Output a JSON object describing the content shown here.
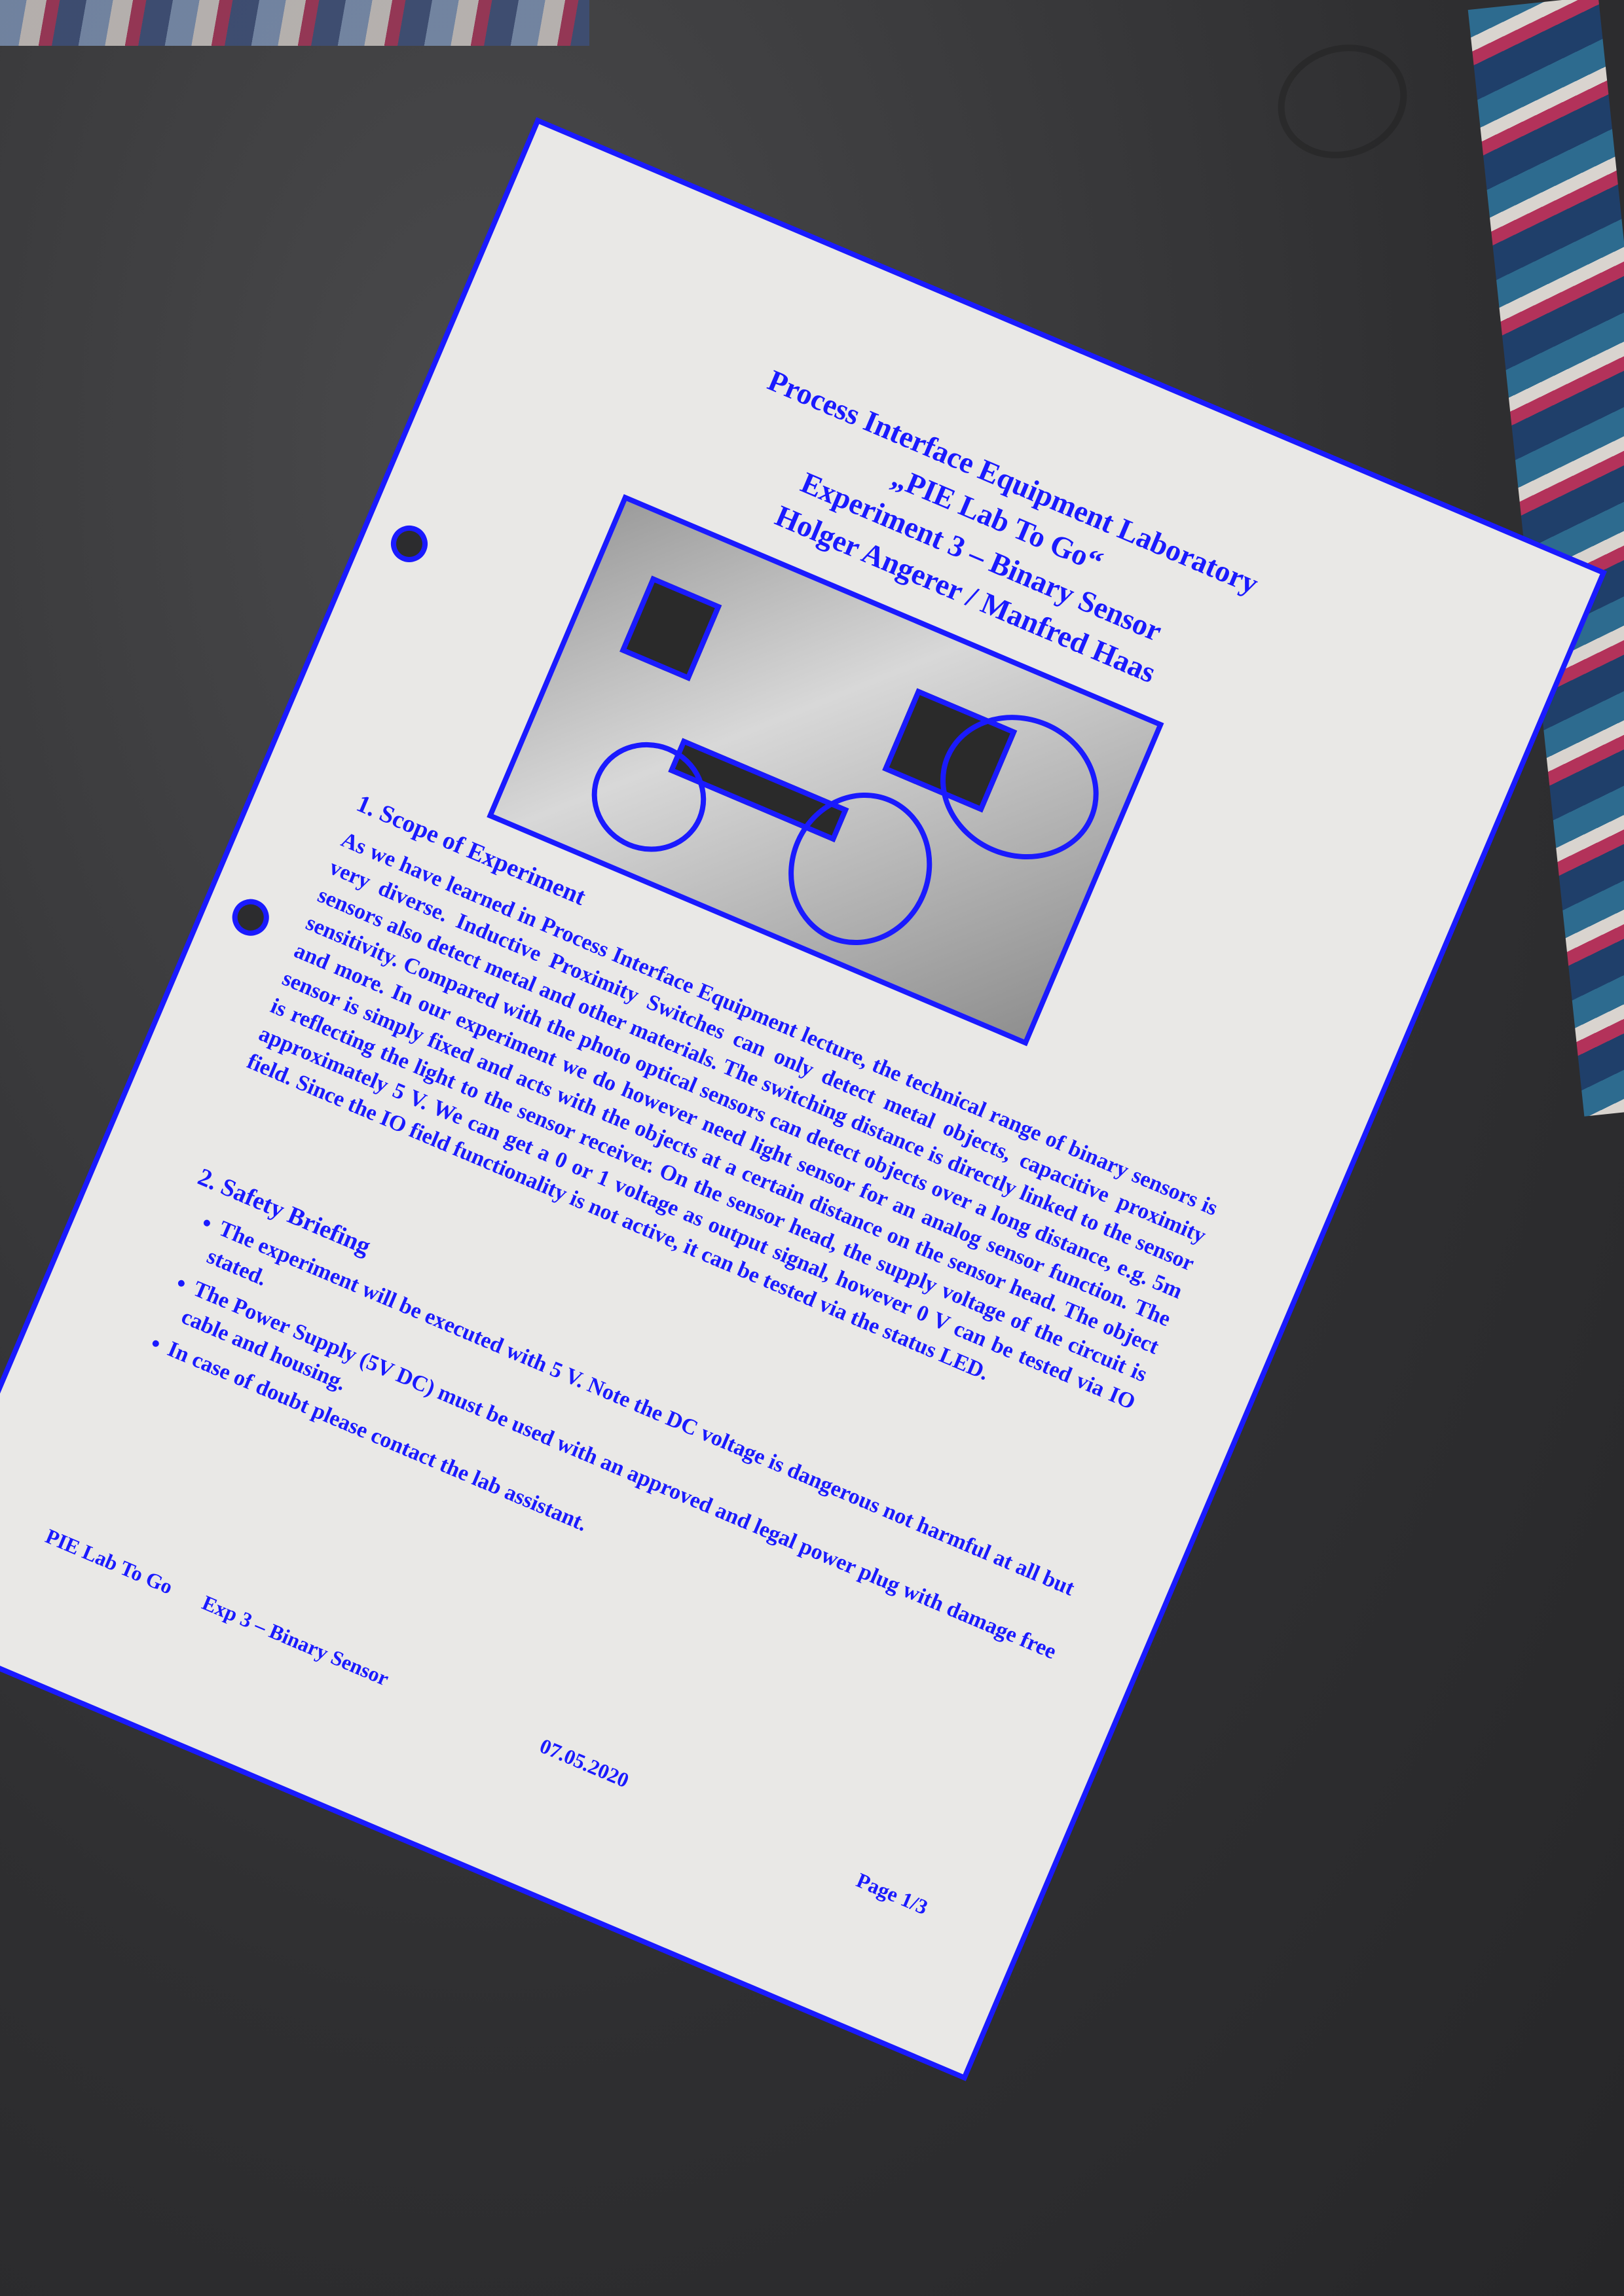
{
  "document": {
    "title_lines": [
      "Process Interface Equipment Laboratory",
      "„PIE Lab To Go“",
      "Experiment 3 – Binary Sensor",
      "Holger Angerer / Manfred Haas"
    ],
    "sections": [
      {
        "heading": "1. Scope of Experiment",
        "text": "As we have learned in Process Interface Equipment lecture, the technical range of binary sensors is very diverse. Inductive Proximity Switches can only detect metal objects, capacitive proximity sensors also detect metal and other materials. The switching distance is directly linked to the sensor sensitivity. Compared with the photo optical sensors can detect objects over a long distance, e.g. 5m and more. In our experiment we do however need light sensor for an analog sensor function. The sensor is simply fixed and acts with the objects at a certain distance on the sensor head. The object is reflecting the light to the sensor receiver. On the sensor head, the supply voltage of the circuit is approximately 5 V. We can get a 0 or 1 voltage as output signal, however 0 V can be tested via IO field. Since the IO field functionality is not active, it can be tested via the status LED."
      },
      {
        "heading": "2. Safety Briefing",
        "bullets": [
          "The experiment will be executed with 5 V. Note the DC voltage is dangerous not harmful at all but stated.",
          "The Power Supply (5V DC) must be used with an approved and legal power plug with damage free cable and housing.",
          "In case of doubt please contact the lab assistant."
        ]
      }
    ],
    "footer": {
      "left": "PIE Lab To Go",
      "center_left": "Exp 3 – Binary Sensor",
      "center": "07.05.2020",
      "right": "Page 1/3"
    }
  }
}
